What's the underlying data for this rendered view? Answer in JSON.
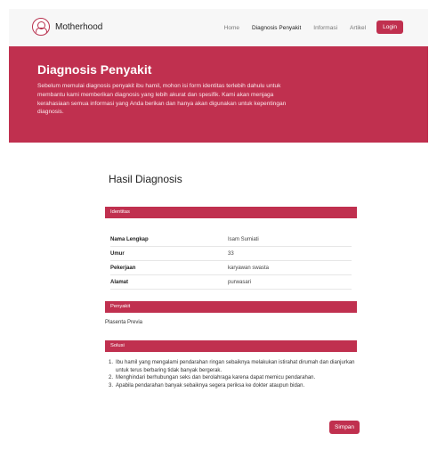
{
  "brand": {
    "name": "Motherhood"
  },
  "nav": {
    "items": [
      {
        "label": "Home"
      },
      {
        "label": "Diagnosis Penyakit"
      },
      {
        "label": "Informasi"
      },
      {
        "label": "Artikel"
      }
    ],
    "login_label": "Login"
  },
  "hero": {
    "title": "Diagnosis Penyakit",
    "description": "Sebelum memulai diagnosis penyakit ibu hamil, mohon isi form identitas terlebih dahulu untuk membantu kami memberikan diagnosis yang lebih akurat dan spesifik. Kami akan menjaga kerahasiaan semua informasi yang Anda berikan dan hanya akan digunakan untuk kepentingan diagnosis."
  },
  "result": {
    "title": "Hasil Diagnosis",
    "identitas": {
      "header": "Identitas",
      "rows": [
        {
          "label": "Nama Lengkap",
          "value": "Isam Sumiati"
        },
        {
          "label": "Umur",
          "value": "33"
        },
        {
          "label": "Pekerjaan",
          "value": "karyawan swasta"
        },
        {
          "label": "Alamat",
          "value": "purwasari"
        }
      ]
    },
    "penyakit": {
      "header": "Penyakit",
      "value": "Plasenta Previa"
    },
    "solusi": {
      "header": "Solusi",
      "items": [
        {
          "num": "1.",
          "text": "Ibu hamil yang mengalami pendarahan ringan sebaiknya melakukan istirahat dirumah dan dianjurkan untuk terus berbaring tidak banyak bergerak."
        },
        {
          "num": "2.",
          "text": "Menghindari berhubungan seks dan berolahraga karena dapat memicu pendarahan."
        },
        {
          "num": "3.",
          "text": "Apabila pendarahan banyak sebaiknya segera periksa ke dokter ataupun bidan."
        }
      ]
    },
    "save_label": "Simpan"
  },
  "colors": {
    "accent": "#c0304f",
    "navbar_bg": "#f7f7f7"
  }
}
